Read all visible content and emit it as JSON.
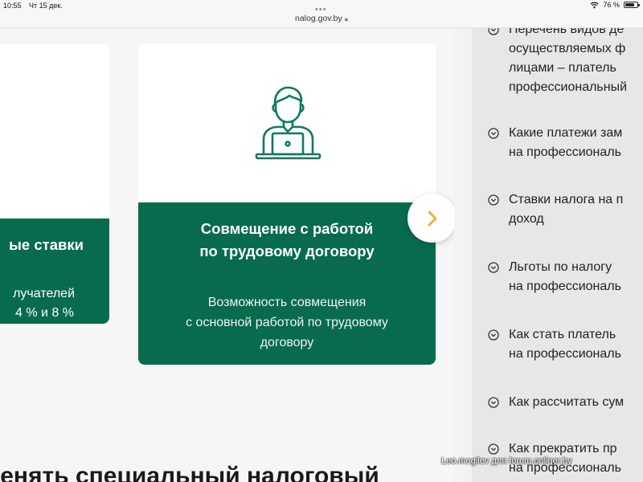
{
  "status": {
    "time": "10:55",
    "date": "Чт 15 дек.",
    "battery": "76 %"
  },
  "browser": {
    "url": "nalog.gov.by"
  },
  "cards": {
    "left": {
      "title": "ые ставки",
      "line1": "лучателей",
      "line2": "4 % и 8 %"
    },
    "main": {
      "title_line1": "Совмещение с работой",
      "title_line2": "по трудовому договору",
      "desc_line1": "Возможность совмещения",
      "desc_line2": "с основной работой по трудовому",
      "desc_line3": "договору",
      "icon": "person-at-laptop-icon"
    }
  },
  "bottom_heading": "менять специальный налоговый",
  "faq": [
    {
      "text": "Перечень видов де\nосуществляемых ф\nлицами – платель\nпрофессиональный"
    },
    {
      "text": "Какие платежи зам\nна профессиональ"
    },
    {
      "text": "Ставки налога на п\nдоход"
    },
    {
      "text": "Льготы по налогу\nна профессиональ"
    },
    {
      "text": "Как стать платель\nна профессиональ"
    },
    {
      "text": "Как рассчитать сум"
    },
    {
      "text": "Как прекратить пр\nна профессиональ"
    }
  ],
  "watermark": "Leo.mogilev для forum.onliner.by",
  "colors": {
    "brand_green": "#086b4e",
    "arrow_yellow": "#e7b23d",
    "sidebar_bg": "#e7e7e7"
  }
}
